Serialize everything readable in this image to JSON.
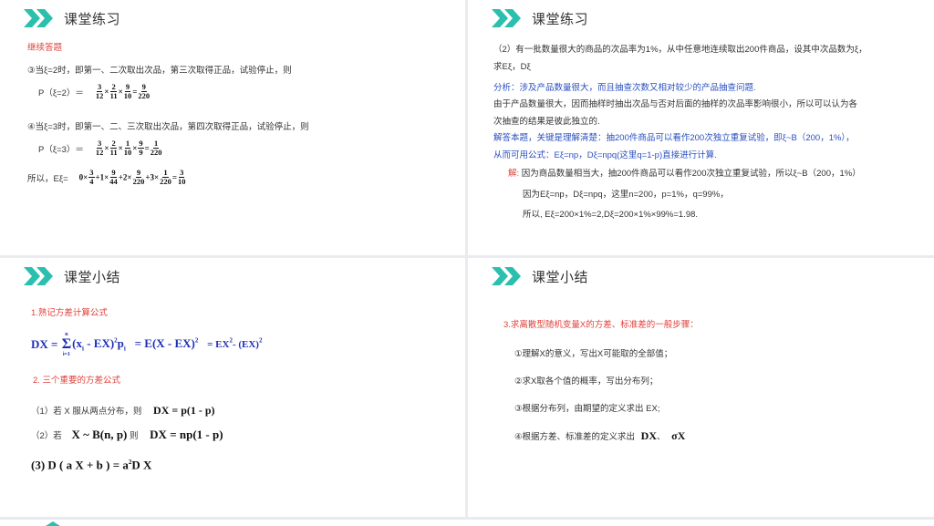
{
  "slides": {
    "s1": {
      "title": "课堂练习",
      "subtitle": "继续答题",
      "case3": "③当ξ=2时，即第一、二次取出次品，第三次取得正品，试验停止，则",
      "p2_label": "P（ξ=2）＝",
      "p2_terms": [
        "3",
        "12",
        "2",
        "11",
        "9",
        "10",
        "9",
        "220"
      ],
      "case4": "④当ξ=3时，即第一、二、三次取出次品，第四次取得正品，试验停止，则",
      "p3_label": "P（ξ=3）＝",
      "p3_terms": [
        "3",
        "12",
        "2",
        "11",
        "1",
        "10",
        "9",
        "9",
        "1",
        "220"
      ],
      "conclusion_label": "所以，Eξ=",
      "e_terms": [
        "0×",
        "3",
        "4",
        "+1×",
        "9",
        "44",
        "+2×",
        "9",
        "220",
        "+3×",
        "1",
        "220",
        "=",
        "3",
        "10"
      ]
    },
    "s2": {
      "title": "课堂练习",
      "problem_line1": "（2）有一批数量很大的商品的次品率为1%，从中任意地连续取出200件商品，设其中次品数为ξ，",
      "problem_line2": "求Eξ，Dξ",
      "analysis": "分析：涉及产品数量很大，而且抽查次数又相对较少的产品抽查问题.",
      "reason_line1": "由于产品数量很大，因而抽样时抽出次品与否对后面的抽样的次品率影响很小，所以可以认为各",
      "reason_line2": "次抽查的结果是彼此独立的.",
      "key_line1": "解答本题，关键是理解清楚：抽200件商品可以看作200次独立重复试验，即ξ~B（200，1%），",
      "key_line2": "从而可用公式：Eξ=np，Dξ=npq(这里q=1-p)直接进行计算.",
      "solution_label": "解:",
      "solution_line1": "因为商品数量相当大，抽200件商品可以看作200次独立重复试验，所以ξ~B（200，1%）",
      "solution_line2": "因为Eξ=np，Dξ=npq，这里n=200，p=1%，q=99%，",
      "solution_line3": "所以, Eξ=200×1%=2,Dξ=200×1%×99%=1.98."
    },
    "s3": {
      "title": "课堂小结",
      "point1": "1.熟记方差计算公式",
      "formula_dx": "DX =",
      "sum_top": "n",
      "sum_bottom": "i=1",
      "formula_part1": "(x",
      "formula_part2": "- EX)",
      "formula_part3": "p",
      "formula_part4": "= E(X - EX)",
      "formula_part5": "= EX",
      "formula_part6": "- (EX)",
      "sq": "2",
      "sub_i": "i",
      "point2": "2. 三个重要的方差公式",
      "item1_label": "（1）若 X 服从两点分布，则",
      "item1_formula": "DX = p(1 - p)",
      "item2_label": "（2）若",
      "item2_dist": "X ~ B(n, p)",
      "item2_then": "则",
      "item2_formula": "DX = np(1 - p)",
      "item3_formula_a": "(3) D ( a X  +  b )  =  a",
      "item3_formula_b": "D X"
    },
    "s4": {
      "title": "课堂小结",
      "heading": "3.求离散型随机变量X的方差、标准差的一般步骤：",
      "step1": "①理解X的意义，写出X可能取的全部值；",
      "step2": "②求X取各个值的概率，写出分布列；",
      "step3": "③根据分布列，由期望的定义求出 EX;",
      "step4": "④根据方差、标准差的定义求出",
      "step4_dx": "DX",
      "step4_sep": "、",
      "step4_sx": "σX"
    }
  },
  "colors": {
    "accent": "#2bbfae",
    "red": "#e0413b",
    "blue": "#2a4fc0",
    "formula_blue": "#1d2fb8"
  },
  "icons": [
    "double-chevron-icon"
  ]
}
